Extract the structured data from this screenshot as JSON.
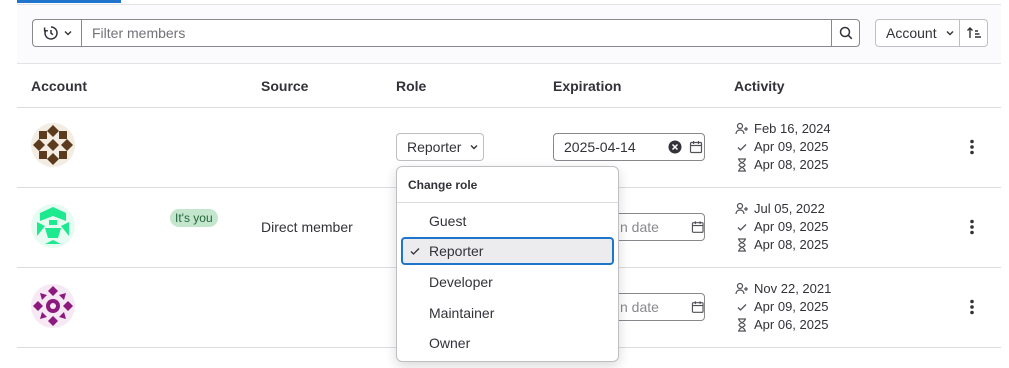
{
  "filter": {
    "placeholder": "Filter members",
    "sort_label": "Account"
  },
  "table": {
    "headers": {
      "account": "Account",
      "source": "Source",
      "role": "Role",
      "expiration": "Expiration",
      "activity": "Activity"
    },
    "rows": [
      {
        "avatar_color": "#5b3a1e",
        "source": "",
        "role": "Reporter",
        "expiration": "2025-04-14",
        "activity": {
          "joined": "Feb 16, 2024",
          "last_activity": "Apr 09, 2025",
          "access_granted": "Apr 08, 2025"
        }
      },
      {
        "avatar_color": "#1de98f",
        "badge": "It's you",
        "source": "Direct member",
        "expiration_placeholder": "n date",
        "activity": {
          "joined": "Jul 05, 2022",
          "last_activity": "Apr 09, 2025",
          "access_granted": "Apr 08, 2025"
        }
      },
      {
        "avatar_color": "#8c1a7e",
        "source": "",
        "expiration_placeholder": "n date",
        "activity": {
          "joined": "Nov 22, 2021",
          "last_activity": "Apr 09, 2025",
          "access_granted": "Apr 06, 2025"
        }
      }
    ]
  },
  "role_dropdown": {
    "header": "Change role",
    "options": [
      "Guest",
      "Reporter",
      "Developer",
      "Maintainer",
      "Owner"
    ],
    "selected": "Reporter"
  },
  "colors": {
    "accent": "#1f75cb",
    "badge_bg": "#c3e6cd",
    "badge_text": "#24663b"
  }
}
